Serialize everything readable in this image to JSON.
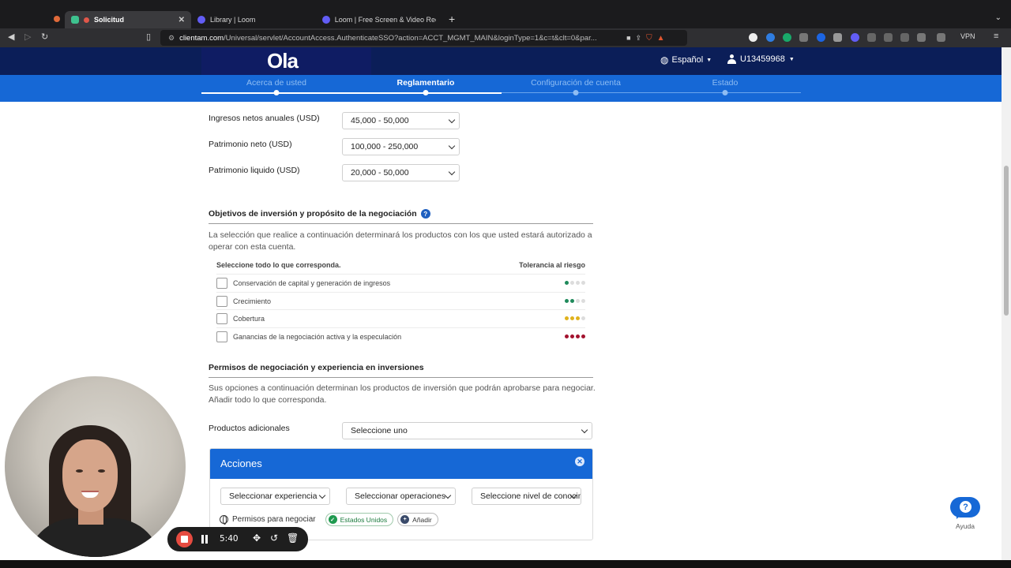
{
  "browser": {
    "tabs": [
      {
        "label": "Solicitud",
        "active": true
      },
      {
        "label": "Library | Loom",
        "active": false
      },
      {
        "label": "Loom | Free Screen & Video Record",
        "active": false
      }
    ],
    "url_domain": "clientam.com",
    "url_path": "/Universal/servlet/AccountAccess.AuthenticateSSO?action=ACCT_MGMT_MAIN&loginType=1&c=t&clt=0&par...",
    "vpn_label": "VPN"
  },
  "header": {
    "logo": "Ola",
    "language": "Español",
    "user_id": "U13459968"
  },
  "stepper": {
    "steps": [
      {
        "label": "Acerca de usted",
        "state": "done"
      },
      {
        "label": "Reglamentario",
        "state": "current"
      },
      {
        "label": "Configuración de cuenta",
        "state": "future"
      },
      {
        "label": "Estado",
        "state": "future"
      }
    ]
  },
  "financial": {
    "fields": [
      {
        "label": "Ingresos netos anuales (USD)",
        "value": "45,000 - 50,000"
      },
      {
        "label": "Patrimonio neto (USD)",
        "value": "100,000 - 250,000"
      },
      {
        "label": "Patrimonio liquido (USD)",
        "value": "20,000 - 50,000"
      }
    ]
  },
  "objectives": {
    "title": "Objetivos de inversión y propósito de la negociación",
    "description": "La selección que realice a continuación determinará los productos con los que usted estará autorizado a operar con esta cuenta.",
    "col_select": "Seleccione todo lo que corresponda.",
    "col_risk": "Tolerancia al riesgo",
    "options": [
      {
        "label": "Conservación de capital y generación de ingresos",
        "risk_level": 1,
        "risk_color": "#1f8a5b"
      },
      {
        "label": "Crecimiento",
        "risk_level": 2,
        "risk_color": "#1f8a5b"
      },
      {
        "label": "Cobertura",
        "risk_level": 3,
        "risk_color": "#e0b21c"
      },
      {
        "label": "Ganancias de la negociación activa y la especulación",
        "risk_level": 4,
        "risk_color": "#a3122e"
      }
    ]
  },
  "permissions": {
    "title": "Permisos de negociación y experiencia en inversiones",
    "description": "Sus opciones a continuación determinan los productos de inversión que podrán aprobarse para negociar. Añadir todo lo que corresponda.",
    "products_label": "Productos adicionales",
    "products_value": "Seleccione uno"
  },
  "actions_panel": {
    "title": "Acciones",
    "selects": [
      "Seleccionar experiencia",
      "Seleccionar operaciones",
      "Seleccione nivel de conocimiento"
    ],
    "perm_label": "Permisos para negociar",
    "country_pill": "Estados Unidos",
    "add_pill": "Añadir"
  },
  "help": {
    "label": "Ayuda"
  },
  "loom": {
    "timer": "5:40"
  },
  "colors": {
    "header_bg": "#0b1e58",
    "accent_blue": "#1668d6",
    "risk_green": "#1f8a5b",
    "risk_yellow": "#e0b21c",
    "risk_red": "#a3122e"
  }
}
